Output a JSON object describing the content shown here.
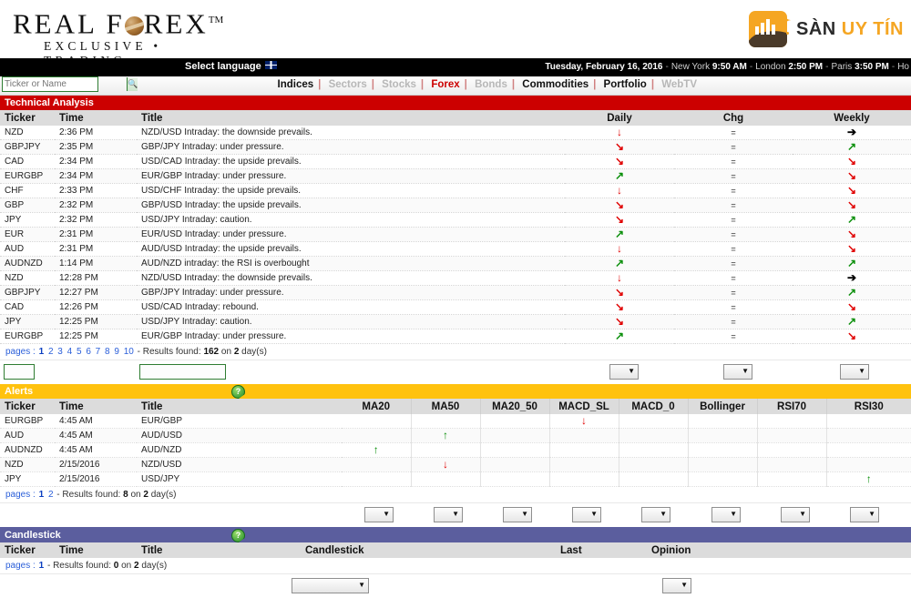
{
  "brand": {
    "logo_line1_a": "REAL F",
    "logo_line1_b": "REX",
    "logo_tm": "TM",
    "logo_line2": "EXCLUSIVE  •  TRADING",
    "partner_a": "SÀN",
    "partner_b": "UY TÍN"
  },
  "topbar": {
    "select_language": "Select language",
    "date": "Tuesday, February 16, 2016",
    "clocks": [
      {
        "city": "New York",
        "time": "9:50 AM"
      },
      {
        "city": "London",
        "time": "2:50 PM"
      },
      {
        "city": "Paris",
        "time": "3:50 PM"
      },
      {
        "city": "Ho",
        "time": ""
      }
    ]
  },
  "search": {
    "placeholder": "Ticker or Name",
    "value": "",
    "icon": "search-icon"
  },
  "nav": {
    "items": [
      {
        "label": "Indices",
        "state": "on"
      },
      {
        "label": "Sectors",
        "state": "off"
      },
      {
        "label": "Stocks",
        "state": "off"
      },
      {
        "label": "Forex",
        "state": "red"
      },
      {
        "label": "Bonds",
        "state": "off"
      },
      {
        "label": "Commodities",
        "state": "on"
      },
      {
        "label": "Portfolio",
        "state": "on"
      },
      {
        "label": "WebTV",
        "state": "off"
      }
    ]
  },
  "technical_analysis": {
    "section_title": "Technical Analysis",
    "columns": [
      "Ticker",
      "Time",
      "Title",
      "Daily",
      "Chg",
      "Weekly"
    ],
    "rows": [
      {
        "ticker": "NZD",
        "time": "2:36 PM",
        "title": "NZD/USD Intraday: the downside prevails.",
        "daily": "down",
        "chg": "flat",
        "weekly": "right"
      },
      {
        "ticker": "GBPJPY",
        "time": "2:35 PM",
        "title": "GBP/JPY Intraday: under pressure.",
        "daily": "down-right",
        "chg": "flat",
        "weekly": "up-right"
      },
      {
        "ticker": "CAD",
        "time": "2:34 PM",
        "title": "USD/CAD Intraday: the upside prevails.",
        "daily": "down-right",
        "chg": "flat",
        "weekly": "down-right"
      },
      {
        "ticker": "EURGBP",
        "time": "2:34 PM",
        "title": "EUR/GBP Intraday: under pressure.",
        "daily": "up-right",
        "chg": "flat",
        "weekly": "down-right"
      },
      {
        "ticker": "CHF",
        "time": "2:33 PM",
        "title": "USD/CHF Intraday: the upside prevails.",
        "daily": "down",
        "chg": "flat",
        "weekly": "down-right"
      },
      {
        "ticker": "GBP",
        "time": "2:32 PM",
        "title": "GBP/USD Intraday: the upside prevails.",
        "daily": "down-right",
        "chg": "flat",
        "weekly": "down-right"
      },
      {
        "ticker": "JPY",
        "time": "2:32 PM",
        "title": "USD/JPY Intraday: caution.",
        "daily": "down-right",
        "chg": "flat",
        "weekly": "up-right"
      },
      {
        "ticker": "EUR",
        "time": "2:31 PM",
        "title": "EUR/USD Intraday: under pressure.",
        "daily": "up-right",
        "chg": "flat",
        "weekly": "down-right"
      },
      {
        "ticker": "AUD",
        "time": "2:31 PM",
        "title": "AUD/USD Intraday: the upside prevails.",
        "daily": "down",
        "chg": "flat",
        "weekly": "down-right"
      },
      {
        "ticker": "AUDNZD",
        "time": "1:14 PM",
        "title": "AUD/NZD intraday: the RSI is overbought",
        "daily": "up-right",
        "chg": "flat",
        "weekly": "up-right"
      },
      {
        "ticker": "NZD",
        "time": "12:28 PM",
        "title": "NZD/USD Intraday: the downside prevails.",
        "daily": "down",
        "chg": "flat",
        "weekly": "right"
      },
      {
        "ticker": "GBPJPY",
        "time": "12:27 PM",
        "title": "GBP/JPY Intraday: under pressure.",
        "daily": "down-right",
        "chg": "flat",
        "weekly": "up-right"
      },
      {
        "ticker": "CAD",
        "time": "12:26 PM",
        "title": "USD/CAD Intraday: rebound.",
        "daily": "down-right",
        "chg": "flat",
        "weekly": "down-right"
      },
      {
        "ticker": "JPY",
        "time": "12:25 PM",
        "title": "USD/JPY Intraday: caution.",
        "daily": "down-right",
        "chg": "flat",
        "weekly": "up-right"
      },
      {
        "ticker": "EURGBP",
        "time": "12:25 PM",
        "title": "EUR/GBP Intraday: under pressure.",
        "daily": "up-right",
        "chg": "flat",
        "weekly": "down-right"
      }
    ],
    "pager": {
      "label": "pages :",
      "pages": [
        "1",
        "2",
        "3",
        "4",
        "5",
        "6",
        "7",
        "8",
        "9",
        "10"
      ],
      "current": "1",
      "sep": "-",
      "results_prefix": "Results found:",
      "results_count": "162",
      "results_mid": "on",
      "results_days": "2",
      "results_suffix": "day(s)"
    },
    "filters": {
      "ticker_value": "",
      "title_value": "",
      "daily_value": "",
      "chg_value": "",
      "weekly_value": ""
    }
  },
  "alerts": {
    "section_title": "Alerts",
    "help_icon": "help-icon",
    "columns": [
      "Ticker",
      "Time",
      "Title",
      "MA20",
      "MA50",
      "MA20_50",
      "MACD_SL",
      "MACD_0",
      "Bollinger",
      "RSI70",
      "RSI30"
    ],
    "rows": [
      {
        "ticker": "EURGBP",
        "time": "4:45 AM",
        "title": "EUR/GBP",
        "ma20": "",
        "ma50": "",
        "ma20_50": "",
        "macd_sl": "down",
        "macd_0": "",
        "bollinger": "",
        "rsi70": "",
        "rsi30": ""
      },
      {
        "ticker": "AUD",
        "time": "4:45 AM",
        "title": "AUD/USD",
        "ma20": "",
        "ma50": "up",
        "ma20_50": "",
        "macd_sl": "",
        "macd_0": "",
        "bollinger": "",
        "rsi70": "",
        "rsi30": ""
      },
      {
        "ticker": "AUDNZD",
        "time": "4:45 AM",
        "title": "AUD/NZD",
        "ma20": "up",
        "ma50": "",
        "ma20_50": "",
        "macd_sl": "",
        "macd_0": "",
        "bollinger": "",
        "rsi70": "",
        "rsi30": ""
      },
      {
        "ticker": "NZD",
        "time": "2/15/2016",
        "title": "NZD/USD",
        "ma20": "",
        "ma50": "down",
        "ma20_50": "",
        "macd_sl": "",
        "macd_0": "",
        "bollinger": "",
        "rsi70": "",
        "rsi30": ""
      },
      {
        "ticker": "JPY",
        "time": "2/15/2016",
        "title": "USD/JPY",
        "ma20": "",
        "ma50": "",
        "ma20_50": "",
        "macd_sl": "",
        "macd_0": "",
        "bollinger": "",
        "rsi70": "",
        "rsi30": "up"
      }
    ],
    "pager": {
      "label": "pages :",
      "pages": [
        "1",
        "2"
      ],
      "current": "1",
      "sep": "-",
      "results_prefix": "Results found:",
      "results_count": "8",
      "results_mid": "on",
      "results_days": "2",
      "results_suffix": "day(s)"
    }
  },
  "candlestick": {
    "section_title": "Candlestick",
    "help_icon": "help-icon",
    "columns": [
      "Ticker",
      "Time",
      "Title",
      "Candlestick",
      "Last",
      "Opinion"
    ],
    "rows": [],
    "pager": {
      "label": "pages :",
      "pages": [
        "1"
      ],
      "current": "1",
      "sep": "-",
      "results_prefix": "Results found:",
      "results_count": "0",
      "results_mid": "on",
      "results_days": "2",
      "results_suffix": "day(s)"
    }
  },
  "colors": {
    "red": "#cc0000",
    "yellow": "#ffc20e",
    "purple": "#5b5e9e",
    "up": "#0a8f0a",
    "down": "#e00000",
    "accent_orange": "#f5a623"
  },
  "glyphs": {
    "up-right": "↗",
    "down-right": "↘",
    "up": "↑",
    "down": "↓",
    "right": "➔",
    "flat": "=",
    "caret": "▼"
  }
}
